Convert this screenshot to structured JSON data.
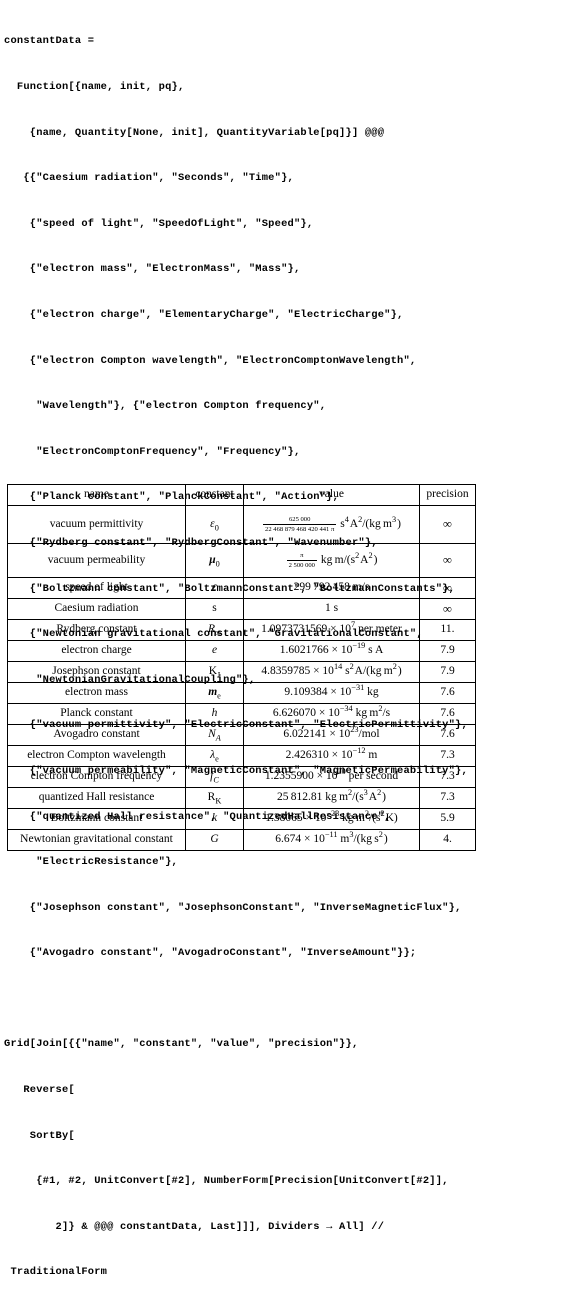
{
  "notebook": {
    "input_cell": {
      "language": "Wolfram Language",
      "lines": [
        "constantData =",
        "  Function[{name, init, pq},",
        "    {name, Quantity[None, init], QuantityVariable[pq]}] @@@",
        "   {{\"Caesium radiation\", \"Seconds\", \"Time\"},",
        "    {\"speed of light\", \"SpeedOfLight\", \"Speed\"},",
        "    {\"electron mass\", \"ElectronMass\", \"Mass\"},",
        "    {\"electron charge\", \"ElementaryCharge\", \"ElectricCharge\"},",
        "    {\"electron Compton wavelength\", \"ElectronComptonWavelength\",",
        "     \"Wavelength\"}, {\"electron Compton frequency\",",
        "     \"ElectronComptonFrequency\", \"Frequency\"},",
        "    {\"Planck constant\", \"PlanckConstant\", \"Action\"},",
        "    {\"Rydberg constant\", \"RydbergConstant\", \"Wavenumber\"},",
        "    {\"Boltzmann constant\", \"BoltzmannConstant\", \"BoltzmannConstants\"},",
        "    {\"Newtonian gravitational constant\", \"GravitationalConstant\",",
        "     \"NewtonianGravitationalCoupling\"},",
        "    {\"vacuum permittivity\", \"ElectricConstant\", \"ElectricPermittivity\"},",
        "    {\"vacuum permeability\", \"MagneticConstant\", \"MagneticPermeability\"},",
        "    {\"quantized Hall resistance\", \"QuantizedHallResistance\",",
        "     \"ElectricResistance\"},",
        "    {\"Josephson constant\", \"JosephsonConstant\", \"InverseMagneticFlux\"},",
        "    {\"Avogadro constant\", \"AvogadroConstant\", \"InverseAmount\"}};",
        "",
        "Grid[Join[{{\"name\", \"constant\", \"value\", \"precision\"}},",
        "   Reverse[",
        "    SortBy[",
        "     {#1, #2, UnitConvert[#2], NumberForm[Precision[UnitConvert[#2]],",
        "        2]} & @@@ constantData, Last]]], Dividers → All] //",
        " TraditionalForm"
      ]
    },
    "output_table": {
      "headers": [
        "name",
        "constant",
        "value",
        "precision"
      ],
      "rows": [
        {
          "name": "vacuum permittivity",
          "symbol": "ε0",
          "value": "625000/(22468879468420441 π) s⁴ A²/(kg m³)",
          "precision": "∞"
        },
        {
          "name": "vacuum permeability",
          "symbol": "μ0",
          "value": "π/2500000 kg m/(s² A²)",
          "precision": "∞"
        },
        {
          "name": "speed of light",
          "symbol": "c",
          "value": "299792458 m/s",
          "precision": "∞"
        },
        {
          "name": "Caesium radiation",
          "symbol": "s",
          "value": "1 s",
          "precision": "∞"
        },
        {
          "name": "Rydberg constant",
          "symbol": "R∞",
          "value": "1.0973731569 × 10⁷ per meter",
          "precision": "11."
        },
        {
          "name": "electron charge",
          "symbol": "e",
          "value": "1.6021766 × 10⁻¹⁹ s A",
          "precision": "7.9"
        },
        {
          "name": "Josephson constant",
          "symbol": "KJ",
          "value": "4.8359785 × 10¹⁴ s² A/(kg m²)",
          "precision": "7.9"
        },
        {
          "name": "electron mass",
          "symbol": "me",
          "value": "9.109384 × 10⁻³¹ kg",
          "precision": "7.6"
        },
        {
          "name": "Planck constant",
          "symbol": "h",
          "value": "6.626070 × 10⁻³⁴ kg m²/s",
          "precision": "7.6"
        },
        {
          "name": "Avogadro constant",
          "symbol": "NA",
          "value": "6.022141 × 10²³/mol",
          "precision": "7.6"
        },
        {
          "name": "electron Compton wavelength",
          "symbol": "λe",
          "value": "2.426310 × 10⁻¹² m",
          "precision": "7.3"
        },
        {
          "name": "electron Compton frequency",
          "symbol": "fC",
          "value": "1.2355900 × 10²⁰ per second",
          "precision": "7.3"
        },
        {
          "name": "quantized Hall resistance",
          "symbol": "RK",
          "value": "25812.81 kg m²/(s³ A²)",
          "precision": "7.3"
        },
        {
          "name": "Boltzmann constant",
          "symbol": "k",
          "value": "1.38065 × 10⁻²³ kg m²/(s² K)",
          "precision": "5.9"
        },
        {
          "name": "Newtonian gravitational constant",
          "symbol": "G",
          "value": "6.674 × 10⁻¹¹ m³/(kg s²)",
          "precision": "4."
        }
      ],
      "fractions": {
        "permittivity_numerator": "625 000",
        "permittivity_denominator": "22 468 879 468 420 441 π",
        "permeability_numerator": "π",
        "permeability_denominator": "2 500 000"
      }
    }
  }
}
